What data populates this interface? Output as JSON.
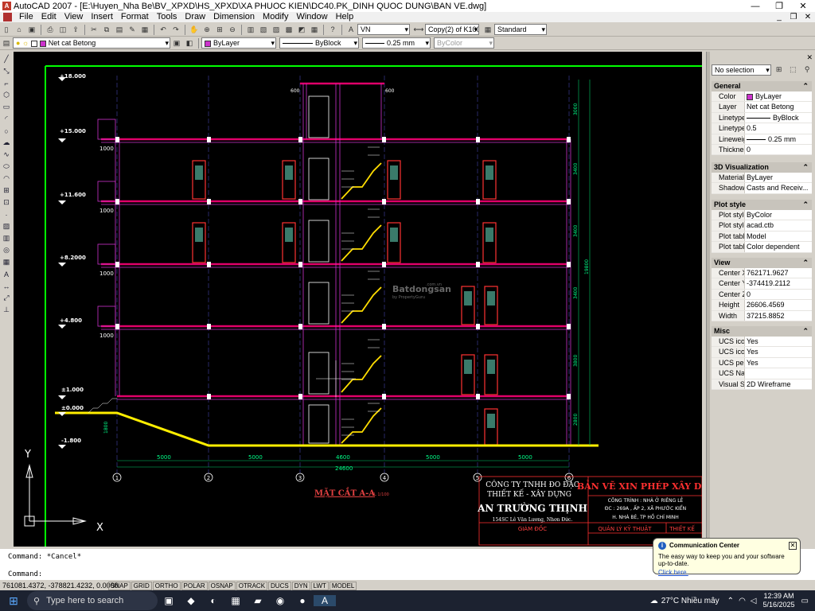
{
  "window": {
    "title": "AutoCAD 2007 - [E:\\Huyen_Nha Be\\BV_XPXD\\HS_XPXD\\XA  PHUOC KIEN\\DC40.PK_DINH QUOC DUNG\\BAN VE.dwg]"
  },
  "menu": [
    "File",
    "Edit",
    "View",
    "Insert",
    "Format",
    "Tools",
    "Draw",
    "Dimension",
    "Modify",
    "Window",
    "Help"
  ],
  "toolbar1": {
    "text_style": "VN",
    "dim_style": "Copy(2) of K100",
    "table_style": "Standard"
  },
  "toolbar2": {
    "layer": "Net cat Betong",
    "color": "ByLayer",
    "linetype": "ByBlock",
    "lineweight": "0.25 mm",
    "plotstyle": "ByColor"
  },
  "drawing": {
    "levels": [
      "+18.000",
      "+15.000",
      "+11.600",
      "+8.2000",
      "+4.800",
      "±1.000",
      "±0.000",
      "-1.800"
    ],
    "beam_label": "1000",
    "parapet_label": "600",
    "bottom_dims": [
      "5000",
      "5000",
      "4600",
      "5000",
      "5000"
    ],
    "total_dim": "24600",
    "grid_axes": [
      "1",
      "2",
      "3",
      "4",
      "5",
      "6"
    ],
    "right_dims": [
      "3000",
      "3400",
      "3400",
      "3400",
      "3800",
      "2800"
    ],
    "right_total": "19800",
    "left_dim": "1800",
    "section_title": "MẶT CẮT A-A",
    "section_scale": "TL 1/100",
    "ucs_x": "X",
    "ucs_y": "Y",
    "watermark": "Batdongsan",
    "watermark_sub": "by PropertyGuru",
    "watermark_domain": ".com.vn",
    "title_block": {
      "company_line1": "CÔNG TY TNHH ĐO ĐẠC",
      "company_line2": "THIẾT KẾ - XÂY DỰNG",
      "company_name": "AN TRƯỜNG THỊNH",
      "company_address": "154SC Lê Văn Lương, Nhơn Đức.",
      "director": "GIÁM ĐỐC",
      "doc_title": "BẢN VẼ XIN PHÉP XÂY DỰN",
      "project": "CÔNG TRÌNH : NHÀ Ở RIÊNG LẺ",
      "address1": "ĐC : 269A , ẤP 2, XÃ PHƯỚC KIỂN",
      "address2": "H. NHÀ BÈ, TP HỒ CHÍ MINH",
      "manager": "QUẢN LÝ KỸ THUẬT",
      "design": "THIẾT KẾ"
    },
    "colors": {
      "frame": "#00ff00",
      "slab": "#e0006a",
      "wall": "#cc33cc",
      "column": "#ffffff",
      "ground": "#ffee00",
      "dim": "#00cc66",
      "level": "#ffffff",
      "title_red": "#ff3030"
    }
  },
  "properties": {
    "selection": "No selection",
    "sections": [
      {
        "title": "General",
        "rows": [
          {
            "k": "Color",
            "v": "ByLayer"
          },
          {
            "k": "Layer",
            "v": "Net cat Betong"
          },
          {
            "k": "Linetype",
            "v": "ByBlock"
          },
          {
            "k": "Linetype s...",
            "v": "0.5"
          },
          {
            "k": "Lineweight",
            "v": "0.25 mm"
          },
          {
            "k": "Thickness",
            "v": "0"
          }
        ]
      },
      {
        "title": "3D Visualization",
        "rows": [
          {
            "k": "Material",
            "v": "ByLayer"
          },
          {
            "k": "Shadow d...",
            "v": "Casts and Receiv..."
          }
        ]
      },
      {
        "title": "Plot style",
        "rows": [
          {
            "k": "Plot style",
            "v": "ByColor"
          },
          {
            "k": "Plot style ...",
            "v": "acad.ctb"
          },
          {
            "k": "Plot table ...",
            "v": "Model"
          },
          {
            "k": "Plot table ...",
            "v": "Color dependent"
          }
        ]
      },
      {
        "title": "View",
        "rows": [
          {
            "k": "Center X",
            "v": "762171.9627"
          },
          {
            "k": "Center Y",
            "v": "-374419.2112"
          },
          {
            "k": "Center Z",
            "v": "0"
          },
          {
            "k": "Height",
            "v": "26606.4569"
          },
          {
            "k": "Width",
            "v": "37215.8852"
          }
        ]
      },
      {
        "title": "Misc",
        "rows": [
          {
            "k": "UCS icon ...",
            "v": "Yes"
          },
          {
            "k": "UCS icon ...",
            "v": "Yes"
          },
          {
            "k": "UCS per v...",
            "v": "Yes"
          },
          {
            "k": "UCS Name",
            "v": ""
          },
          {
            "k": "Visual Style",
            "v": "2D Wireframe"
          }
        ]
      }
    ]
  },
  "command": {
    "line1": "Command: *Cancel*",
    "line2": "Command:"
  },
  "status": {
    "coords": "761081.4372, -378821.4232, 0.0000",
    "buttons": [
      "SNAP",
      "GRID",
      "ORTHO",
      "POLAR",
      "OSNAP",
      "OTRACK",
      "DUCS",
      "DYN",
      "LWT",
      "MODEL"
    ]
  },
  "notification": {
    "title": "Communication Center",
    "body": "The easy way to keep you and your software up-to-date.",
    "link": "Click here."
  },
  "taskbar": {
    "search_placeholder": "Type here to search",
    "weather": "27°C  Nhiều mây",
    "time": "12:39 AM",
    "date": "5/16/2025"
  }
}
